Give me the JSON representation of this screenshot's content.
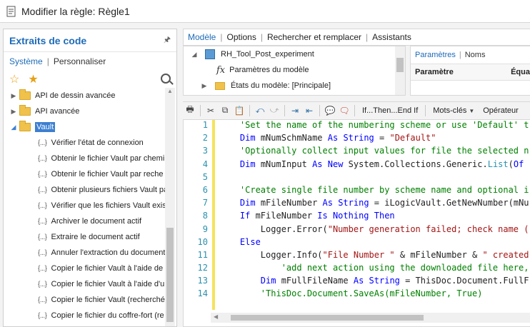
{
  "window": {
    "title": "Modifier la règle: Règle1"
  },
  "left": {
    "title": "Extraits de code",
    "pin": "📌",
    "segments": [
      "Système",
      "Personnaliser"
    ],
    "tree": [
      {
        "label": "API de dessin avancée",
        "type": "folder",
        "expanded": false
      },
      {
        "label": "API avancée",
        "type": "folder",
        "expanded": false
      },
      {
        "label": "Vault",
        "type": "folder",
        "expanded": true,
        "selected": true
      },
      {
        "label": "Vérifier l'état de connexion",
        "type": "snippet"
      },
      {
        "label": "Obtenir le fichier Vault par chemi",
        "type": "snippet"
      },
      {
        "label": "Obtenir le fichier Vault par reche",
        "type": "snippet"
      },
      {
        "label": "Obtenir plusieurs fichiers Vault pa",
        "type": "snippet"
      },
      {
        "label": "Vérifier que les fichiers Vault exis",
        "type": "snippet"
      },
      {
        "label": "Archiver le document actif",
        "type": "snippet"
      },
      {
        "label": "Extraire le document actif",
        "type": "snippet"
      },
      {
        "label": "Annuler l'extraction du document",
        "type": "snippet"
      },
      {
        "label": "Copier le fichier Vault à l'aide de",
        "type": "snippet"
      },
      {
        "label": "Copier le fichier Vault à l'aide d'ur",
        "type": "snippet"
      },
      {
        "label": "Copier le fichier Vault (recherché",
        "type": "snippet"
      },
      {
        "label": "Copier le fichier du coffre-fort (re",
        "type": "snippet"
      }
    ],
    "snippet_glyph": "{...}"
  },
  "right": {
    "tabs": [
      "Modèle",
      "Options",
      "Rechercher et remplacer",
      "Assistants"
    ],
    "model_tree": [
      {
        "label": "RH_Tool_Post_experiment",
        "icon": "part-cube-icon"
      },
      {
        "label": "Paramètres du modèle",
        "icon": "fx-icon"
      },
      {
        "label": "États du modèle: [Principale]",
        "icon": "folder-icon"
      }
    ],
    "fx": "fx",
    "param_tabs": [
      "Paramètres",
      "Noms"
    ],
    "param_columns": [
      "Paramètre",
      "Équa"
    ],
    "toolbar": {
      "ifthen": "If...Then...End If",
      "keywords": "Mots-clés",
      "operators": "Opérateur"
    }
  },
  "code": {
    "line_numbers": [
      "1",
      "2",
      "3",
      "4",
      "5",
      "6",
      "7",
      "8",
      "9",
      "10",
      "11",
      "12",
      "13",
      "14"
    ]
  }
}
